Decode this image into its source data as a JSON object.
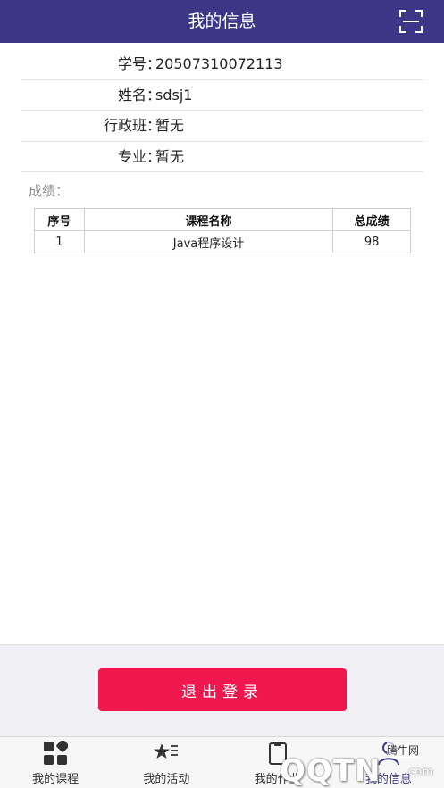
{
  "header": {
    "title": "我的信息",
    "scan_icon": "scan-frame-icon"
  },
  "info": [
    {
      "label": "学号：",
      "value": "20507310072113"
    },
    {
      "label": "姓名：",
      "value": "sdsj1"
    },
    {
      "label": "行政班：",
      "value": "暂无"
    },
    {
      "label": "专业：",
      "value": "暂无"
    }
  ],
  "scores": {
    "title": "成绩：",
    "columns": [
      "序号",
      "课程名称",
      "总成绩"
    ],
    "rows": [
      [
        "1",
        "Java程序设计",
        "98"
      ]
    ]
  },
  "logout_label": "退出登录",
  "tabs": [
    {
      "label": "我的课程",
      "icon": "grid-icon"
    },
    {
      "label": "我的活动",
      "icon": "star-list-icon"
    },
    {
      "label": "我的作业",
      "icon": "clipboard-icon"
    },
    {
      "label": "我的信息",
      "icon": "user-icon"
    }
  ],
  "colors": {
    "primary": "#3b3786",
    "logout": "#f0174e",
    "background_bottom": "#efeff4"
  },
  "watermark": {
    "text": "QQTN",
    "domain": ".com",
    "site": "腾牛网"
  }
}
